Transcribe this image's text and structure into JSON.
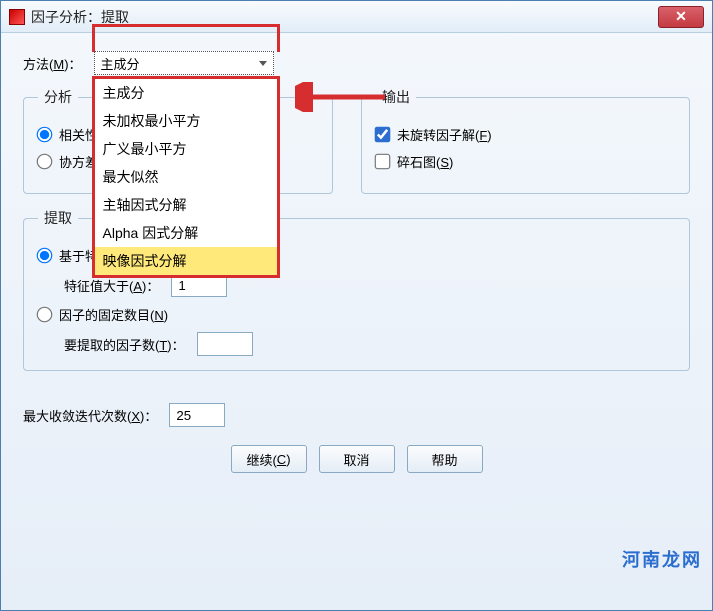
{
  "title": "因子分析：提取",
  "method": {
    "label_pre": "方法(",
    "mn": "M",
    "label_post": ")：",
    "selected": "主成分",
    "options": [
      "主成分",
      "未加权最小平方",
      "广义最小平方",
      "最大似然",
      "主轴因式分解",
      "Alpha 因式分解",
      "映像因式分解"
    ],
    "highlight_index": 6
  },
  "analyze": {
    "legend": "分析",
    "opt1": "相关性",
    "opt2": "协方差",
    "selected": 0
  },
  "output": {
    "legend": "输出",
    "chk1_pre": "未旋转因子解(",
    "chk1_mn": "F",
    "chk1_post": ")",
    "chk1_checked": true,
    "chk2_pre": "碎石图(",
    "chk2_mn": "S",
    "chk2_post": ")",
    "chk2_checked": false
  },
  "extract": {
    "legend": "提取",
    "opt1": "基于特",
    "eig_label_pre": "特征值大于(",
    "eig_mn": "A",
    "eig_label_post": ")：",
    "eig_value": "1",
    "opt2_pre": "因子的固定数目(",
    "opt2_mn": "N",
    "opt2_post": ")",
    "num_label_pre": "要提取的因子数(",
    "num_mn": "T",
    "num_label_post": ")：",
    "num_value": "",
    "selected": 0
  },
  "maxiter": {
    "label_pre": "最大收敛迭代次数(",
    "mn": "X",
    "label_post": ")：",
    "value": "25"
  },
  "buttons": {
    "cont_pre": "继续(",
    "cont_mn": "C",
    "cont_post": ")",
    "cancel": "取消",
    "help": "帮助"
  },
  "watermark": "河南龙网"
}
